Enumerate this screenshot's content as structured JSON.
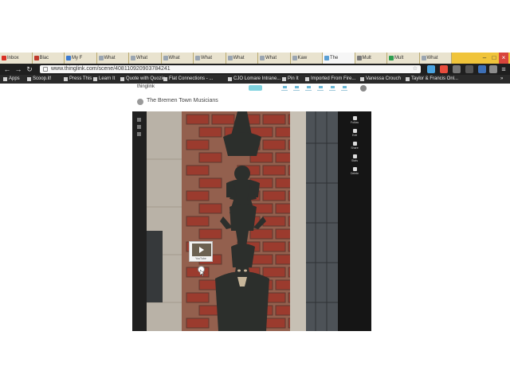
{
  "browser": {
    "tabs": [
      {
        "label": "Inbox",
        "fav": "#d93025"
      },
      {
        "label": "Blac",
        "fav": "#c0392b"
      },
      {
        "label": "My F",
        "fav": "#3b7bd1"
      },
      {
        "label": "What",
        "fav": "#9aa5b1"
      },
      {
        "label": "What",
        "fav": "#9aa5b1"
      },
      {
        "label": "What",
        "fav": "#9aa5b1"
      },
      {
        "label": "What",
        "fav": "#9aa5b1"
      },
      {
        "label": "What",
        "fav": "#9aa5b1"
      },
      {
        "label": "What",
        "fav": "#9aa5b1"
      },
      {
        "label": "Kaw",
        "fav": "#9aa5b1"
      },
      {
        "label": "The",
        "fav": "#5a9fd4"
      },
      {
        "label": "Mult",
        "fav": "#7a7a7a"
      },
      {
        "label": "Mult",
        "fav": "#2e9e4f"
      },
      {
        "label": "What",
        "fav": "#9aa5b1"
      }
    ],
    "active_tab_index": 10,
    "url": "www.thinglink.com/scene/408110920903784241",
    "bookmarks": [
      {
        "label": "Apps"
      },
      {
        "label": "Scoop.it!"
      },
      {
        "label": "Press This"
      },
      {
        "label": "Learn It"
      },
      {
        "label": "Quote with Quozio"
      },
      {
        "label": "Flat Connections - ..."
      },
      {
        "label": "CJO Lomare Intrane..."
      },
      {
        "label": "Pin It"
      },
      {
        "label": "Imported From Fire..."
      },
      {
        "label": "Vanessa Crouch"
      },
      {
        "label": "Taylor & Francis Onl..."
      }
    ],
    "bookmark_more": "»"
  },
  "page": {
    "site_logo": "thinglink",
    "image_title": "The Bremen Town Musicians",
    "colors": {
      "accent": "#7fd3df",
      "panel_bg": "#1c1c1c"
    },
    "tools": [
      {
        "label": "Follow"
      },
      {
        "label": "Edit"
      },
      {
        "label": "Share"
      },
      {
        "label": "Stats"
      },
      {
        "label": "Delete"
      }
    ],
    "tag_thumb_label": "YouTube"
  },
  "icons": {
    "back": "←",
    "forward": "→",
    "reload": "↻",
    "menu": "≡",
    "star": "☆",
    "minimize": "–",
    "maximize": "□",
    "close": "×"
  }
}
